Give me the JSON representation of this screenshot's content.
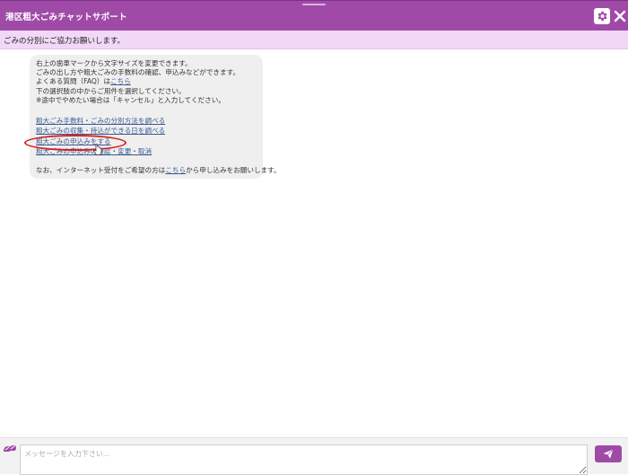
{
  "header": {
    "title": "港区粗大ごみチャットサポート"
  },
  "notice": {
    "text": "ごみの分別にご協力お願いします。"
  },
  "message": {
    "line1": "右上の歯車マークから文字サイズを変更できます。",
    "line2": "ごみの出し方や粗大ごみの手数料の確認、申込みなどができます。",
    "faq_prefix": "よくある質問（FAQ）は",
    "faq_link": "こちら",
    "line4": "下の選択肢の中からご用件を選択してください。",
    "line5": "※途中でやめたい場合は「キャンセル」と入力してください。",
    "options": [
      "粗大ごみ手数料・ごみの分別方法を調べる",
      "粗大ごみの収集・持込ができる日を調べる",
      "粗大ごみの申込みをする",
      "粗大ごみの申込みの確認・変更・取消"
    ],
    "footer_prefix": "なお、インターネット受付をご希望の方は",
    "footer_link": "こちら",
    "footer_suffix": "から申し込みをお願いします。"
  },
  "input": {
    "placeholder": "メッセージを入力下さい..."
  },
  "colors": {
    "accent": "#a04aa8",
    "notice_bg": "#f0d8f6",
    "highlight": "#d62020"
  },
  "icons": {
    "settings": "gear-icon",
    "close": "close-icon",
    "send": "paper-plane-icon",
    "logo": "chat-logo-icon"
  }
}
